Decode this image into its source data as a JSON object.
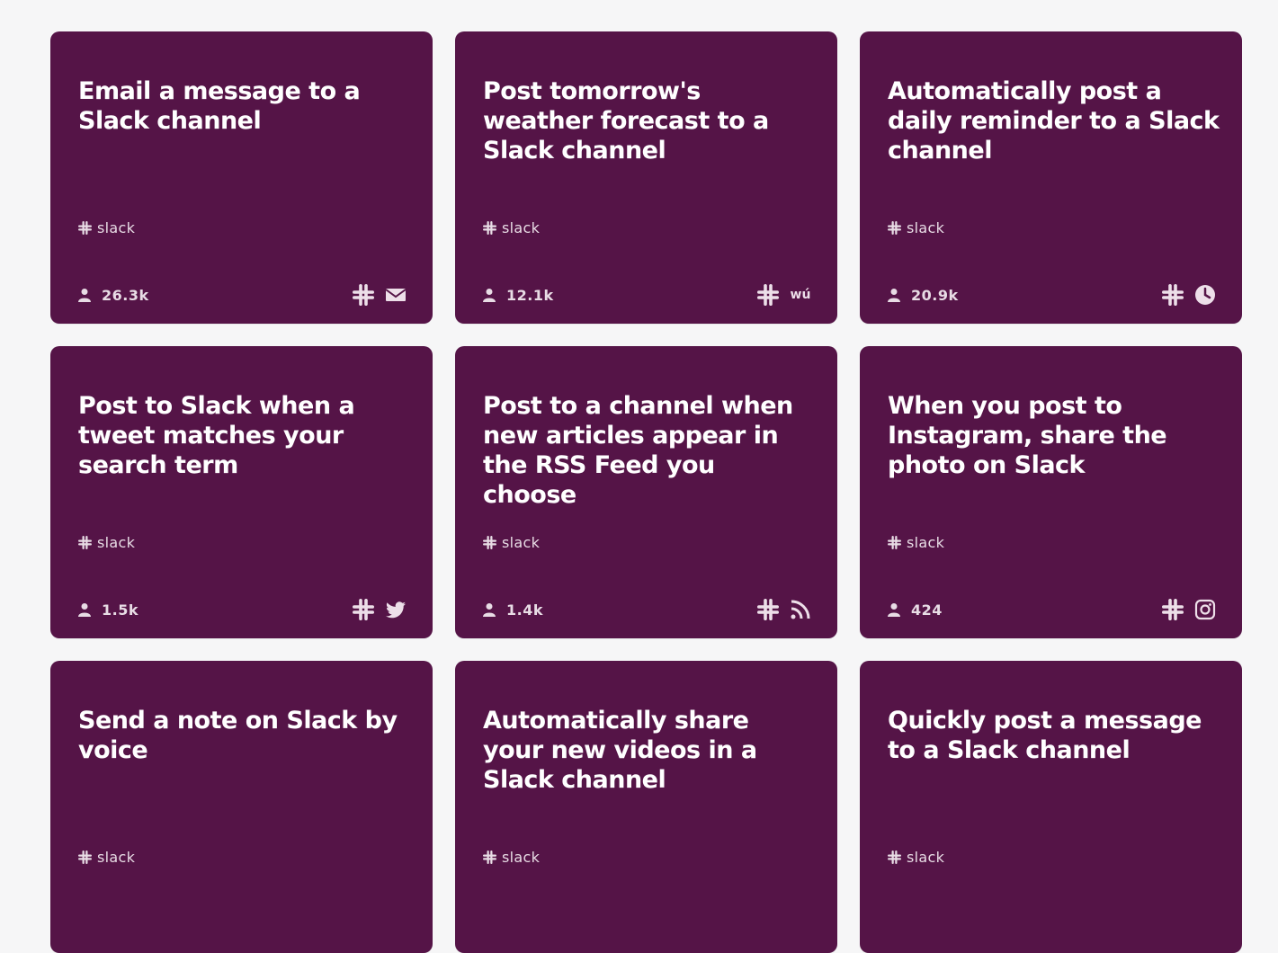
{
  "cards": [
    {
      "title": "Email a message to a Slack channel",
      "service": "slack",
      "users": "26.3k",
      "icons": [
        "slack-icon",
        "email-icon"
      ]
    },
    {
      "title": "Post tomorrow's weather forecast to a Slack channel",
      "service": "slack",
      "users": "12.1k",
      "icons": [
        "slack-icon",
        "weather-underground-icon"
      ],
      "wu_text": "wú"
    },
    {
      "title": "Automatically post a daily reminder to a Slack channel",
      "service": "slack",
      "users": "20.9k",
      "icons": [
        "slack-icon",
        "clock-icon"
      ]
    },
    {
      "title": "Post to Slack when a tweet matches your search term",
      "service": "slack",
      "users": "1.5k",
      "icons": [
        "slack-icon",
        "twitter-icon"
      ]
    },
    {
      "title": "Post to a channel when new articles appear in the RSS Feed you choose",
      "service": "slack",
      "users": "1.4k",
      "icons": [
        "slack-icon",
        "rss-icon"
      ]
    },
    {
      "title": "When you post to Instagram, share the photo on Slack",
      "service": "slack",
      "users": "424",
      "icons": [
        "slack-icon",
        "instagram-icon"
      ]
    },
    {
      "title": "Send a note on Slack by voice",
      "service": "slack",
      "users": "",
      "icons": [
        "slack-icon"
      ]
    },
    {
      "title": "Automatically share your new videos in a Slack channel",
      "service": "slack",
      "users": "",
      "icons": [
        "slack-icon"
      ]
    },
    {
      "title": "Quickly post a message to a Slack channel",
      "service": "slack",
      "users": "",
      "icons": [
        "slack-icon"
      ]
    }
  ],
  "colors": {
    "background": "#f6f6f7",
    "card": "#551447",
    "text": "#ffffff",
    "muted": "#e8dce5"
  }
}
